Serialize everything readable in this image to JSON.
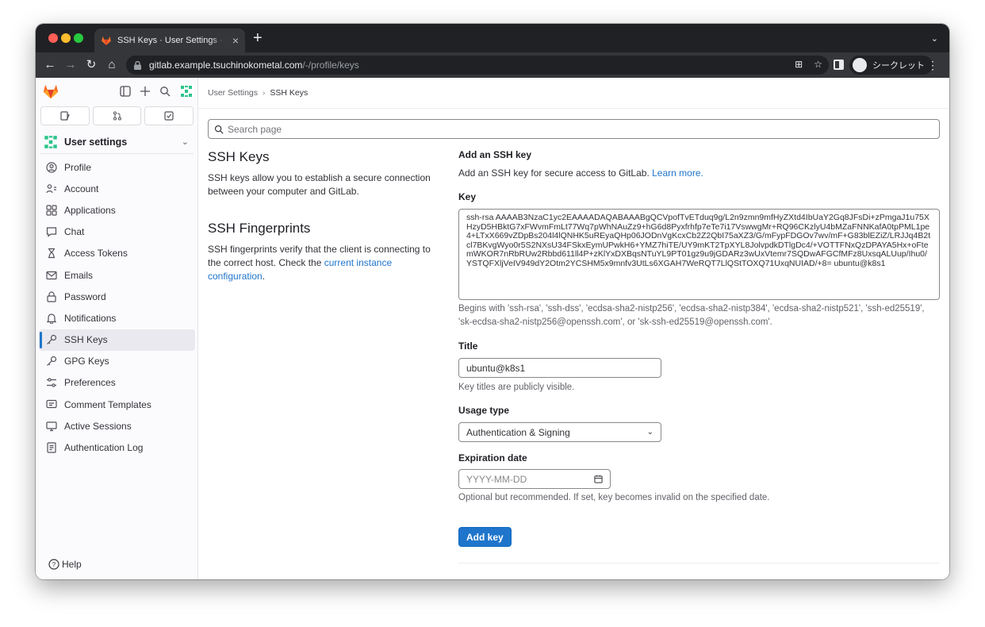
{
  "browser": {
    "tab_title": "SSH Keys · User Settings · GitLab",
    "new_tab": "+",
    "url_host": "gitlab.example.tsuchinokometal.com",
    "url_path": "/-/profile/keys",
    "incognito_label": "シークレット"
  },
  "sidebar": {
    "context_label": "User settings",
    "items": [
      {
        "label": "Profile",
        "icon": "user-icon"
      },
      {
        "label": "Account",
        "icon": "account-icon"
      },
      {
        "label": "Applications",
        "icon": "applications-icon"
      },
      {
        "label": "Chat",
        "icon": "chat-icon"
      },
      {
        "label": "Access Tokens",
        "icon": "token-icon"
      },
      {
        "label": "Emails",
        "icon": "mail-icon"
      },
      {
        "label": "Password",
        "icon": "lock-icon"
      },
      {
        "label": "Notifications",
        "icon": "bell-icon"
      },
      {
        "label": "SSH Keys",
        "icon": "key-icon",
        "active": true
      },
      {
        "label": "GPG Keys",
        "icon": "key-icon"
      },
      {
        "label": "Preferences",
        "icon": "preferences-icon"
      },
      {
        "label": "Comment Templates",
        "icon": "comment-icon"
      },
      {
        "label": "Active Sessions",
        "icon": "monitor-icon"
      },
      {
        "label": "Authentication Log",
        "icon": "log-icon"
      }
    ],
    "help_label": "Help"
  },
  "breadcrumb": {
    "parent": "User Settings",
    "current": "SSH Keys"
  },
  "search": {
    "placeholder": "Search page"
  },
  "left": {
    "ssh_keys_title": "SSH Keys",
    "ssh_keys_desc": "SSH keys allow you to establish a secure connection between your computer and GitLab.",
    "fingerprints_title": "SSH Fingerprints",
    "fingerprints_desc_before": "SSH fingerprints verify that the client is connecting to the correct host. Check the ",
    "fingerprints_link": "current instance configuration",
    "fingerprints_desc_after": "."
  },
  "form": {
    "add_title": "Add an SSH key",
    "add_desc": "Add an SSH key for secure access to GitLab. ",
    "learn_more": "Learn more.",
    "key_label": "Key",
    "key_value": "ssh-rsa AAAAB3NzaC1yc2EAAAADAQABAAABgQCVpofTvETduq9g/L2n9zmn9mfHyZXtd4IbUaY2Gq8JFsDi+zPmgaJ1u75XHzyD5HBktG7xFWvmFmLt77Wq7pWhNAuZz9+hG6d8Pyxfrhfp7eTe7i17VswwgMr+RQ96CKzlyU4bMZaFNNKafA0tpPML1pe4+LTxX669vZDpBs204l4lQNHK5uREyaQHp06JODnVgKcxCb2Z2QbI75aXZ3/G/mFypFDGOv7wv/mF+G83blEZiZ/LRJJq4B2tcl7BKvgWyo0r5S2NXsU34FSkxEymUPwkH6+YMZ7hiTE/UY9mKT2TpXYL8JolvpdkDTlgDc4/+VOTTFNxQzDPAYA5Hx+oFtemWKOR7nRbRUw2Rbbd611ll4P+zKlYxDXBqsNTuYL9PT01gz9u9jGDARz3wUxVtemr7SQDwAFGCfMFz8UxsqALUup/Ihu0/YSTQFXljVeIV949dY2Otm2YCSHM5x9mnfv3UtLs6XGAH7WeRQT7LlQStTOXQ71UxqNUIAD/+8= ubuntu@k8s1",
    "key_hint": "Begins with 'ssh-rsa', 'ssh-dss', 'ecdsa-sha2-nistp256', 'ecdsa-sha2-nistp384', 'ecdsa-sha2-nistp521', 'ssh-ed25519', 'sk-ecdsa-sha2-nistp256@openssh.com', or 'sk-ssh-ed25519@openssh.com'.",
    "title_label": "Title",
    "title_value": "ubuntu@k8s1",
    "title_hint": "Key titles are publicly visible.",
    "usage_label": "Usage type",
    "usage_value": "Authentication & Signing",
    "expiration_label": "Expiration date",
    "expiration_placeholder": "YYYY-MM-DD",
    "expiration_hint": "Optional but recommended. If set, key becomes invalid on the specified date.",
    "submit_label": "Add key"
  },
  "colors": {
    "primary": "#1f75cb",
    "brand_orange": "#fc6d26"
  }
}
